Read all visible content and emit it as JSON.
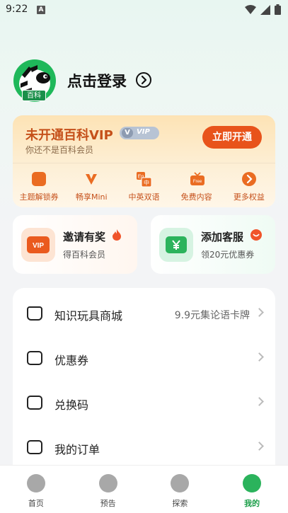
{
  "status_bar": {
    "time": "9:22",
    "notification_letter": "A"
  },
  "profile": {
    "avatar_badge": "百科",
    "login_label": "点击登录"
  },
  "vip": {
    "title": "未开通百科VIP",
    "pill_v": "V",
    "pill_text": "VIP",
    "subtitle": "你还不是百科会员",
    "open_button": "立即开通",
    "benefits": [
      {
        "label": "主题解锁券",
        "icon": "theme-icon"
      },
      {
        "label": "畅享Mini",
        "icon": "mini-v-icon"
      },
      {
        "label": "中英双语",
        "icon": "bilingual-icon",
        "icon_text_top": "En",
        "icon_text_bottom": "中"
      },
      {
        "label": "免费内容",
        "icon": "free-tv-icon",
        "icon_text": "Free"
      },
      {
        "label": "更多权益",
        "icon": "more-arrow-icon"
      }
    ]
  },
  "promos": {
    "invite": {
      "title": "邀请有奖",
      "subtitle": "得百科会员",
      "icon_text": "VIP"
    },
    "service": {
      "title": "添加客服",
      "subtitle": "领20元优惠券"
    }
  },
  "menu": [
    {
      "label": "知识玩具商城",
      "value": "9.9元集论语卡牌"
    },
    {
      "label": "优惠券",
      "value": ""
    },
    {
      "label": "兑换码",
      "value": ""
    },
    {
      "label": "我的订单",
      "value": ""
    }
  ],
  "nav": [
    {
      "label": "首页",
      "active": false
    },
    {
      "label": "预告",
      "active": false
    },
    {
      "label": "探索",
      "active": false
    },
    {
      "label": "我的",
      "active": true
    }
  ],
  "colors": {
    "accent": "#e8531b",
    "vip_text": "#c5501a",
    "active_green": "#1a9e48"
  }
}
